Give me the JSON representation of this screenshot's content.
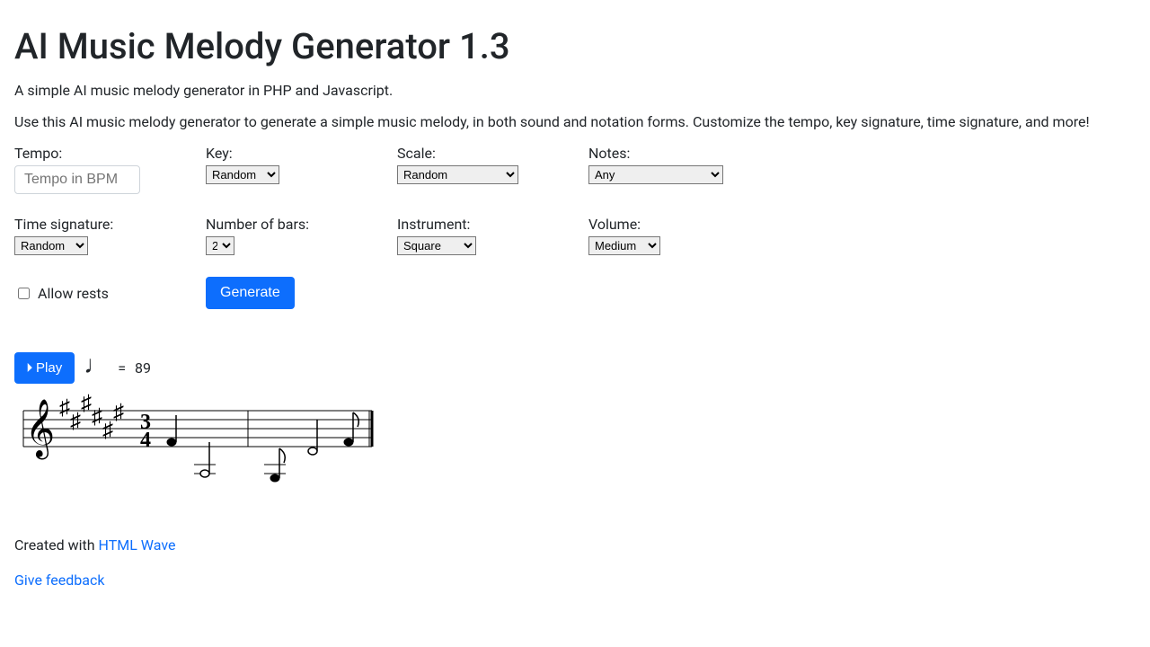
{
  "header": {
    "title": "AI Music Melody Generator 1.3",
    "subtitle": "A simple AI music melody generator in PHP and Javascript.",
    "description": "Use this AI music melody generator to generate a simple music melody, in both sound and notation forms. Customize the tempo, key signature, time signature, and more!"
  },
  "form": {
    "tempo_label": "Tempo:",
    "tempo_placeholder": "Tempo in BPM",
    "tempo_value": "",
    "key_label": "Key:",
    "key_value": "Random",
    "scale_label": "Scale:",
    "scale_value": "Random",
    "notes_label": "Notes:",
    "notes_value": "Any",
    "timesig_label": "Time signature:",
    "timesig_value": "Random",
    "bars_label": "Number of bars:",
    "bars_value": "2",
    "instrument_label": "Instrument:",
    "instrument_value": "Square",
    "volume_label": "Volume:",
    "volume_value": "Medium",
    "allow_rests_label": "Allow rests",
    "generate_label": "Generate"
  },
  "playback": {
    "play_label": "Play",
    "tempo_equals": "=",
    "tempo_value": "89"
  },
  "notation": {
    "time_signature_top": "3",
    "time_signature_bottom": "4",
    "sharps_count": 6
  },
  "footer": {
    "created_with_prefix": "Created with ",
    "created_with_link": "HTML Wave",
    "feedback_link": "Give feedback"
  }
}
